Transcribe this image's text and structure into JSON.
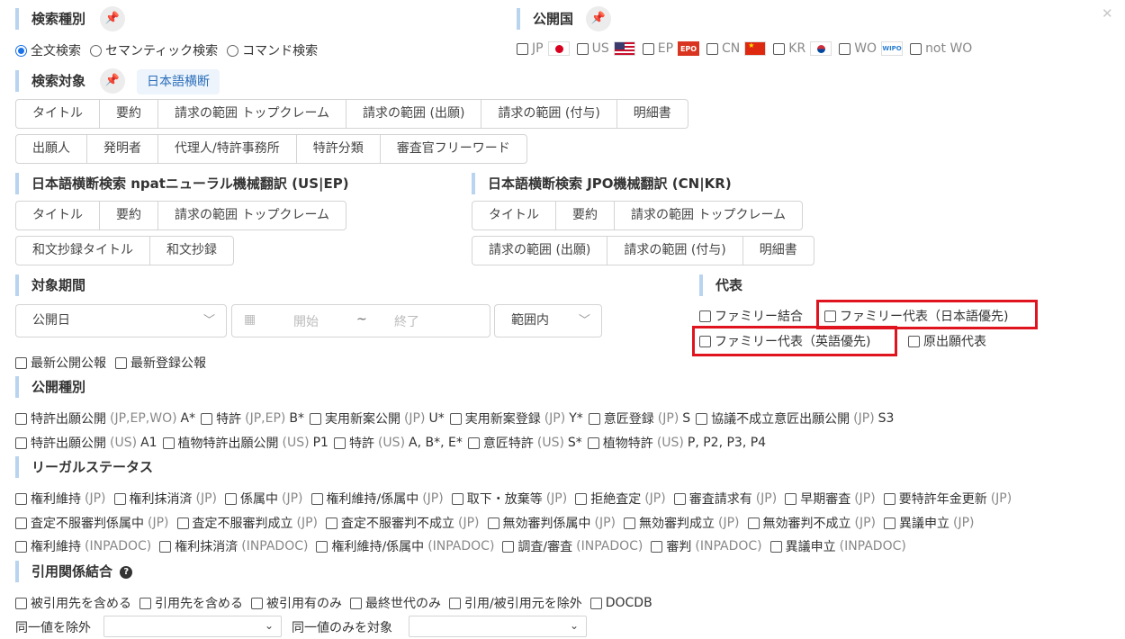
{
  "close_icon": "✕",
  "search_type": {
    "title": "検索種別",
    "options": [
      "全文検索",
      "セマンティック検索",
      "コマンド検索"
    ],
    "selected_index": 0
  },
  "country": {
    "title": "公開国",
    "items": [
      {
        "label": "JP",
        "flag": "flag-jp"
      },
      {
        "label": "US",
        "flag": "flag-us"
      },
      {
        "label": "EP",
        "flag": "flag-ep",
        "flag_text": "EPO"
      },
      {
        "label": "CN",
        "flag": "flag-cn"
      },
      {
        "label": "KR",
        "flag": "flag-kr"
      },
      {
        "label": "WO",
        "flag": "flag-wo",
        "flag_text": "WIPO"
      },
      {
        "label": "not WO",
        "flag": ""
      }
    ]
  },
  "target": {
    "title": "検索対象",
    "tag": "日本語横断",
    "row1": [
      "タイトル",
      "要約",
      "請求の範囲 トップクレーム",
      "請求の範囲 (出願)",
      "請求の範囲 (付与)",
      "明細書"
    ],
    "row2": [
      "出願人",
      "発明者",
      "代理人/特許事務所",
      "特許分類",
      "審査官フリーワード"
    ]
  },
  "npat": {
    "title": "日本語横断検索 npatニューラル機械翻訳 (US|EP)",
    "row1": [
      "タイトル",
      "要約",
      "請求の範囲 トップクレーム"
    ],
    "row2": [
      "和文抄録タイトル",
      "和文抄録"
    ]
  },
  "jpo": {
    "title": "日本語横断検索 JPO機械翻訳 (CN|KR)",
    "row1": [
      "タイトル",
      "要約",
      "請求の範囲 トップクレーム"
    ],
    "row2": [
      "請求の範囲 (出願)",
      "請求の範囲 (付与)",
      "明細書"
    ]
  },
  "period": {
    "title": "対象期間",
    "date_type": "公開日",
    "start_placeholder": "開始",
    "tilde": "~",
    "end_placeholder": "終了",
    "range": "範囲内",
    "latest_pub": "最新公開公報",
    "latest_reg": "最新登録公報"
  },
  "rep": {
    "title": "代表",
    "family_merge": "ファミリー結合",
    "family_rep_jp": "ファミリー代表（日本語優先)",
    "family_rep_en": "ファミリー代表（英語優先)",
    "orig_rep": "原出願代表"
  },
  "pub_type": {
    "title": "公開種別",
    "row1": [
      {
        "t": "特許出願公開",
        "m": "(JP,EP,WO)",
        "s": "A*"
      },
      {
        "t": "特許",
        "m": "(JP,EP)",
        "s": "B*"
      },
      {
        "t": "実用新案公開",
        "m": "(JP)",
        "s": "U*"
      },
      {
        "t": "実用新案登録",
        "m": "(JP)",
        "s": "Y*"
      },
      {
        "t": "意匠登録",
        "m": "(JP)",
        "s": "S"
      },
      {
        "t": "協議不成立意匠出願公開",
        "m": "(JP)",
        "s": "S3"
      }
    ],
    "row2": [
      {
        "t": "特許出願公開",
        "m": "(US)",
        "s": "A1"
      },
      {
        "t": "植物特許出願公開",
        "m": "(US)",
        "s": "P1"
      },
      {
        "t": "特許",
        "m": "(US)",
        "s": "A, B*, E*"
      },
      {
        "t": "意匠特許",
        "m": "(US)",
        "s": "S*"
      },
      {
        "t": "植物特許",
        "m": "(US)",
        "s": "P, P2, P3, P4"
      }
    ]
  },
  "legal": {
    "title": "リーガルステータス",
    "row1": [
      {
        "t": "権利維持",
        "m": "(JP)"
      },
      {
        "t": "権利抹消済",
        "m": "(JP)"
      },
      {
        "t": "係属中",
        "m": "(JP)"
      },
      {
        "t": "権利維持/係属中",
        "m": "(JP)"
      },
      {
        "t": "取下・放棄等",
        "m": "(JP)"
      },
      {
        "t": "拒絶査定",
        "m": "(JP)"
      },
      {
        "t": "審査請求有",
        "m": "(JP)"
      },
      {
        "t": "早期審査",
        "m": "(JP)"
      },
      {
        "t": "要特許年金更新",
        "m": "(JP)"
      }
    ],
    "row2": [
      {
        "t": "査定不服審判係属中",
        "m": "(JP)"
      },
      {
        "t": "査定不服審判成立",
        "m": "(JP)"
      },
      {
        "t": "査定不服審判不成立",
        "m": "(JP)"
      },
      {
        "t": "無効審判係属中",
        "m": "(JP)"
      },
      {
        "t": "無効審判成立",
        "m": "(JP)"
      },
      {
        "t": "無効審判不成立",
        "m": "(JP)"
      },
      {
        "t": "異議申立",
        "m": "(JP)"
      }
    ],
    "row3": [
      {
        "t": "権利維持",
        "m": "(INPADOC)"
      },
      {
        "t": "権利抹消済",
        "m": "(INPADOC)"
      },
      {
        "t": "権利維持/係属中",
        "m": "(INPADOC)"
      },
      {
        "t": "調査/審査",
        "m": "(INPADOC)"
      },
      {
        "t": "審判",
        "m": "(INPADOC)"
      },
      {
        "t": "異議申立",
        "m": "(INPADOC)"
      }
    ]
  },
  "citation": {
    "title": "引用関係結合",
    "help_icon": "?",
    "options": [
      "被引用先を含める",
      "引用先を含める",
      "被引用有のみ",
      "最終世代のみ",
      "引用/被引用元を除外",
      "DOCDB"
    ],
    "exclude_same_label": "同一値を除外",
    "only_same_label": "同一値のみを対象"
  }
}
